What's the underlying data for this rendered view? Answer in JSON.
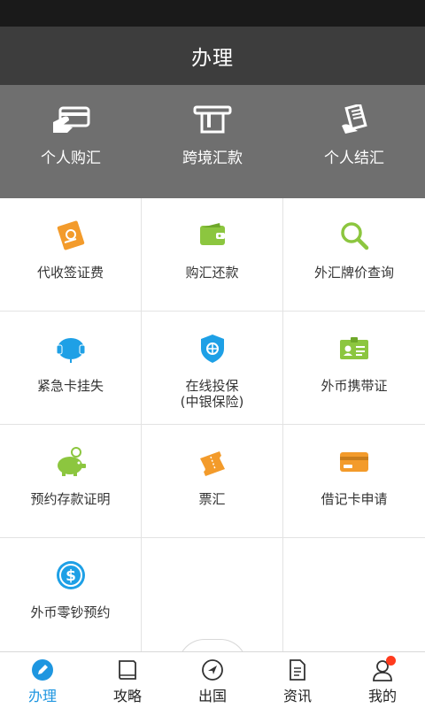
{
  "header": {
    "title": "办理"
  },
  "quick_actions": [
    {
      "label": "个人购汇",
      "icon": "hand-card-icon"
    },
    {
      "label": "跨境汇款",
      "icon": "atm-card-icon"
    },
    {
      "label": "个人结汇",
      "icon": "receipt-hand-icon"
    }
  ],
  "services": [
    {
      "label": "代收签证费",
      "icon": "passport-icon",
      "color": "#f39b2b"
    },
    {
      "label": "购汇还款",
      "icon": "wallet-icon",
      "color": "#8cc63f"
    },
    {
      "label": "外汇牌价查询",
      "icon": "magnifier-icon",
      "color": "#8cc63f"
    },
    {
      "label": "紧急卡挂失",
      "icon": "headset-icon",
      "color": "#1ea0e6"
    },
    {
      "label": "在线投保",
      "sublabel": "(中银保险)",
      "icon": "shield-icon",
      "color": "#1ea0e6"
    },
    {
      "label": "外币携带证",
      "icon": "id-card-icon",
      "color": "#8cc63f"
    },
    {
      "label": "预约存款证明",
      "icon": "piggy-bank-icon",
      "color": "#8cc63f"
    },
    {
      "label": "票汇",
      "icon": "ticket-icon",
      "color": "#f39b2b"
    },
    {
      "label": "借记卡申请",
      "icon": "bank-card-icon",
      "color": "#f39b2b"
    },
    {
      "label": "外币零钞预约",
      "icon": "dollar-coin-icon",
      "color": "#1ea0e6"
    }
  ],
  "tabs": [
    {
      "label": "办理",
      "icon": "pen-icon",
      "active": true
    },
    {
      "label": "攻略",
      "icon": "book-icon"
    },
    {
      "label": "出国",
      "icon": "compass-icon"
    },
    {
      "label": "资讯",
      "icon": "document-icon"
    },
    {
      "label": "我的",
      "icon": "user-icon"
    }
  ],
  "colors": {
    "accent": "#1e96e0",
    "badge": "#ff3b1e",
    "header_bg": "#3d3d3d",
    "quick_bg": "#6f6f6f"
  }
}
